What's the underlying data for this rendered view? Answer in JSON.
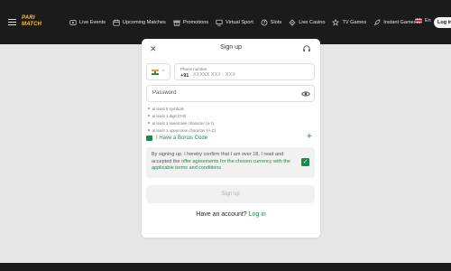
{
  "logo": {
    "line1": "PARI",
    "line2": "MATCH",
    "color": "#ffc21a"
  },
  "nav": [
    {
      "label": "Live Events",
      "icon": "live-events-icon"
    },
    {
      "label": "Upcoming Matches",
      "icon": "calendar-icon"
    },
    {
      "label": "Promotions",
      "icon": "gift-icon"
    },
    {
      "label": "Virtual Sport",
      "icon": "monitor-icon"
    },
    {
      "label": "Slots",
      "icon": "slots-icon"
    },
    {
      "label": "Live Casino",
      "icon": "casino-icon"
    },
    {
      "label": "TV Games",
      "icon": "tv-icon"
    },
    {
      "label": "Instant Games",
      "icon": "rocket-icon"
    }
  ],
  "header": {
    "language": "En",
    "login_label": "Log in"
  },
  "modal": {
    "title": "Sign up",
    "phone": {
      "label": "Phone number",
      "code": "+91",
      "placeholder": "XXXXX XXX - XXX"
    },
    "password": {
      "placeholder": "Password"
    },
    "rules": [
      "at least 8 symbols",
      "at least 1 digit (0-9)",
      "at least 1 lowercase character (a-z)",
      "at least 1 uppercase character (A-Z)"
    ],
    "bonus_label": "I Have a Bonus Code",
    "consent": {
      "text": "By signing up, I hereby confirm that I am over 18, I read and accepted the ",
      "link": "offer agreements for the chosen currency with the applicable terms and conditions",
      "checked": true
    },
    "signup_label": "Sign up",
    "have_account": "Have an account?",
    "login_link": "Log in"
  },
  "colors": {
    "accent": "#1e8a47",
    "topbar": "#1b1b1b",
    "background": "#e6e6e6"
  }
}
